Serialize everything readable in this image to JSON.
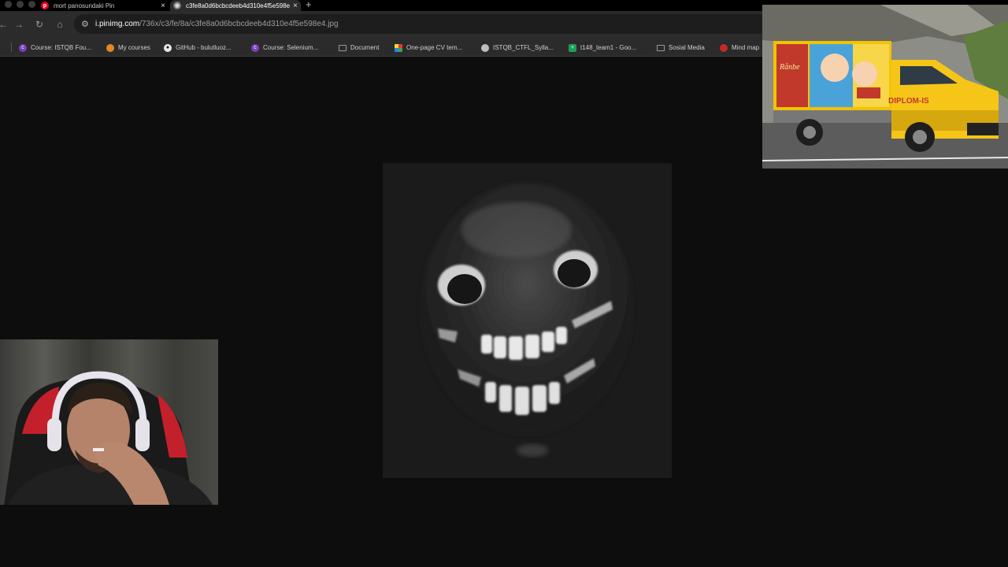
{
  "browser": {
    "tabs": [
      {
        "title": "mort panosundaki Pin",
        "icon": "pinterest-icon",
        "active": false
      },
      {
        "title": "c3fe8a0d6bcbcdeeb4d310e4f5e598e4.jpg",
        "icon": "image-file-icon",
        "active": true
      }
    ],
    "new_tab_label": "+",
    "close_label": "×",
    "address": {
      "host": "i.pinimg.com",
      "path": "/736x/c3/fe/8a/c3fe8a0d6bcbcdeeb4d310e4f5e598e4.jpg"
    }
  },
  "bookmarks": [
    {
      "label": "Course: ISTQB Fou...",
      "icon": "moodle-icon",
      "color": "#7b3fbf"
    },
    {
      "label": "My courses",
      "icon": "orange-site-icon",
      "color": "#e2892a"
    },
    {
      "label": "GitHub - bulutluoz...",
      "icon": "github-icon",
      "color": "#e8e8e8"
    },
    {
      "label": "Course: Selenium...",
      "icon": "moodle-icon",
      "color": "#7b3fbf"
    },
    {
      "label": "Document",
      "icon": "folder-icon",
      "color": "#9a9a9a"
    },
    {
      "label": "One-page CV tem...",
      "icon": "grid-icon",
      "color": "#e53935"
    },
    {
      "label": "ISTQB_CTFL_Sylla...",
      "icon": "globe-icon",
      "color": "#bdbdbd"
    },
    {
      "label": "t148_team1 - Goo...",
      "icon": "google-sheets-icon",
      "color": "#1e9e57"
    },
    {
      "label": "Sosial Media",
      "icon": "folder-icon",
      "color": "#9a9a9a"
    },
    {
      "label": "Mind map",
      "icon": "red-site-icon",
      "color": "#c62828"
    }
  ],
  "overlays": {
    "truck": {
      "brand_text": "DIPLOM-IS",
      "side_text": "Rånbe"
    }
  },
  "colors": {
    "tab_bar": "#000000",
    "toolbar": "#2b2b2b",
    "page_background": "#0d0d0d",
    "truck_yellow": "#f5c518"
  }
}
